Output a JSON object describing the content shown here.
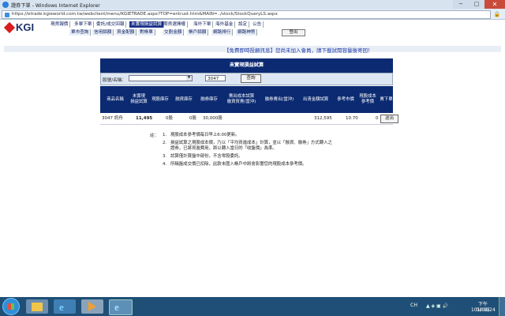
{
  "window": {
    "title": "證券下單 - Windows Internet Explorer",
    "close": "✕",
    "min": "−",
    "max": "□"
  },
  "address": {
    "url": "https://etrade.kgieworld.com.tw/webclient/menu/KGIETRADE.aspx?TOP=entrust.htm&MAIN=../stock/StockQueryLS.aspx"
  },
  "site": {
    "logo": "KGI",
    "nav_row1": [
      "現貨報價",
      "多單下單",
      "委託/成交回報",
      "未實現損益試算",
      "期貨選擇權",
      "海外下單",
      "海外基金",
      "設定",
      "公告"
    ],
    "nav_row2": [
      "單市查詢",
      "信用餘額",
      "資金配額",
      "對帳單",
      "交割金額",
      "帳戶餘額",
      "網路排行",
      "網路神幣"
    ],
    "logout": "登出",
    "promo": "【免費即時投顧訊息】您尚未加入會員，請下載試閱容量後寄回！"
  },
  "panel": {
    "title": "未實現損益試算",
    "stock_label": "股號/名稱：",
    "code_value": "3047",
    "query_label": "查詢",
    "headers": [
      "商品名稱",
      "未實現\n損益試算",
      "現股庫存",
      "融資庫存",
      "融券庫存",
      "賣出成本試算\n融資買賣(當沖)",
      "融券賣出(當沖)",
      "出清金額試算",
      "參考市價",
      "現股成本\n參考價",
      "賣下單"
    ],
    "row": {
      "name": "3047 訊舟",
      "pnl": "11,495",
      "cash": "0股",
      "margin": "0股",
      "short": "30,000股",
      "proceeds": "312,595",
      "price": "10.70",
      "cost": "0",
      "action": "送出"
    }
  },
  "notes": {
    "label": "註：",
    "items": [
      "現股成本參考價每日早上6:00更新。",
      "損益試算之現股成本價，乃以「平均買進成本」計算，並以「融資、融券」方式轉入之",
      "證券，已將買進費用，將以轉入當日的「收盤價」為準。",
      "試算僅計算盤中部份，不含零股委託。",
      "所稱盤成交價已扣除，此款未匯入帳戶中將會影響您的現股成本參考價。"
    ],
    "nums": [
      "1.",
      "2.",
      "3.",
      "4."
    ]
  },
  "taskbar": {
    "lang": "CH",
    "tray": "▲ ◈ ▣ 🔊",
    "time": "下午 04:15",
    "date": "101/04/24"
  }
}
